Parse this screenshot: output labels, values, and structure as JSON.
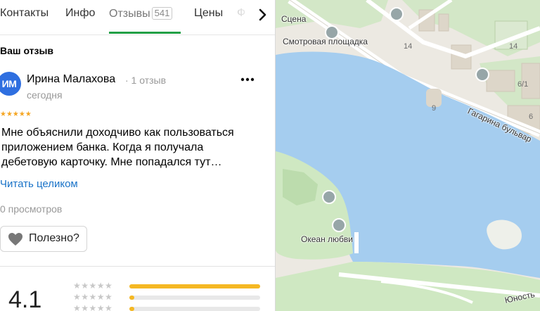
{
  "tabs": [
    {
      "label": "Контакты"
    },
    {
      "label": "Инфо"
    },
    {
      "label": "Отзывы",
      "count": "541",
      "active": true
    },
    {
      "label": "Цены"
    },
    {
      "label": "Ф"
    }
  ],
  "review_section": {
    "title": "Ваш отзыв"
  },
  "review": {
    "avatar_initials": "ИМ",
    "author": "Ирина Малахова",
    "author_meta": "· 1 отзыв",
    "date": "сегодня",
    "more_label": "•••",
    "stars": "★★★★★",
    "rating": 5,
    "text": "Мне объяснили доходчиво как пользоваться приложением банка. Когда я получала дебетовую карточку. Мне попадался тут…",
    "read_more": "Читать целиком",
    "views": "0 просмотров",
    "useful_label": "Полезно?"
  },
  "summary": {
    "rating": "4.1",
    "distribution": [
      {
        "stars": "★★★★★",
        "fraction": 1.0
      },
      {
        "stars": "★★★★★",
        "fraction": 0.04
      },
      {
        "stars": "★★★★★",
        "fraction": 0.04
      }
    ]
  },
  "map": {
    "labels": {
      "scene": "Сцена",
      "viewpoint": "Смотровая площадка",
      "boulevard": "Гагарина бульвар",
      "ocean": "Океан любви",
      "youth": "Юность"
    },
    "numbers": {
      "b14a": "14",
      "b14b": "14",
      "b9": "9",
      "b61": "6/1",
      "b6": "6"
    }
  },
  "colors": {
    "accent": "#22a046",
    "link": "#1a73c8",
    "star": "#f5a623",
    "water": "#a5cdef",
    "park": "#cfe8c2",
    "avatar": "#2f6fe0"
  }
}
